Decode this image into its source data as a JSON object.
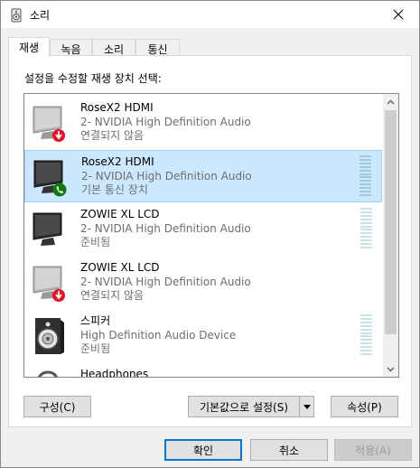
{
  "window": {
    "title": "소리"
  },
  "tabs": [
    "재생",
    "녹음",
    "소리",
    "통신"
  ],
  "prompt": "설정을 수정할 재생 장치 선택:",
  "devices": [
    {
      "name": "RoseX2 HDMI",
      "desc": "2- NVIDIA High Definition Audio",
      "status": "연결되지 않음",
      "icon": "monitor-icon",
      "badge": "disconnected-badge-icon",
      "selected": false,
      "meter": false
    },
    {
      "name": "RoseX2 HDMI",
      "desc": "2- NVIDIA High Definition Audio",
      "status": "기본 통신 장치",
      "icon": "monitor-icon",
      "badge": "communication-phone-badge-icon",
      "selected": true,
      "meter": true
    },
    {
      "name": "ZOWIE XL LCD",
      "desc": "2- NVIDIA High Definition Audio",
      "status": "준비됨",
      "icon": "monitor-icon",
      "badge": "",
      "selected": false,
      "meter": true
    },
    {
      "name": "ZOWIE XL LCD",
      "desc": "2- NVIDIA High Definition Audio",
      "status": "연결되지 않음",
      "icon": "monitor-icon",
      "badge": "disconnected-badge-icon",
      "selected": false,
      "meter": false
    },
    {
      "name": "스피커",
      "desc": "High Definition Audio Device",
      "status": "준비됨",
      "icon": "speaker-icon",
      "badge": "",
      "selected": false,
      "meter": true
    },
    {
      "name": "Headphones",
      "desc": "",
      "status": "",
      "icon": "headphones-icon",
      "badge": "",
      "selected": false,
      "meter": false
    }
  ],
  "buttons": {
    "configure": "구성(C)",
    "set_default": "기본값으로 설정(S)",
    "properties": "속성(P)",
    "ok": "확인",
    "cancel": "취소",
    "apply": "적용(A)"
  },
  "colors": {
    "selection": "#cce8ff",
    "selection_border": "#99d1ff",
    "default_button_border": "#0078d7",
    "disconnected_badge": "#e81123",
    "communication_badge": "#107c10"
  }
}
